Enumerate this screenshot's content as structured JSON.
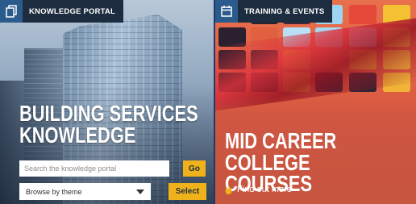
{
  "knowledge_portal": {
    "tag_label": "KNOWLEDGE PORTAL",
    "headline_line1": "BUILDING SERVICES",
    "headline_line2": "KNOWLEDGE",
    "search_placeholder": "Search the knowledge portal",
    "go_label": "Go",
    "browse_label": "Browse by theme",
    "select_label": "Select"
  },
  "training": {
    "tag_label": "TRAINING & EVENTS",
    "headline_line1": "MID CAREER COLLEGE",
    "headline_line2": "COURSES",
    "find_more_label": "Find out more"
  },
  "colors": {
    "page_bg": "#1f3a6a",
    "tag_bg": "#1d2d3f",
    "tag_icon_bg": "#2b5b8c",
    "button_yellow": "#f0b21b",
    "training_bg": "#d8624a"
  }
}
